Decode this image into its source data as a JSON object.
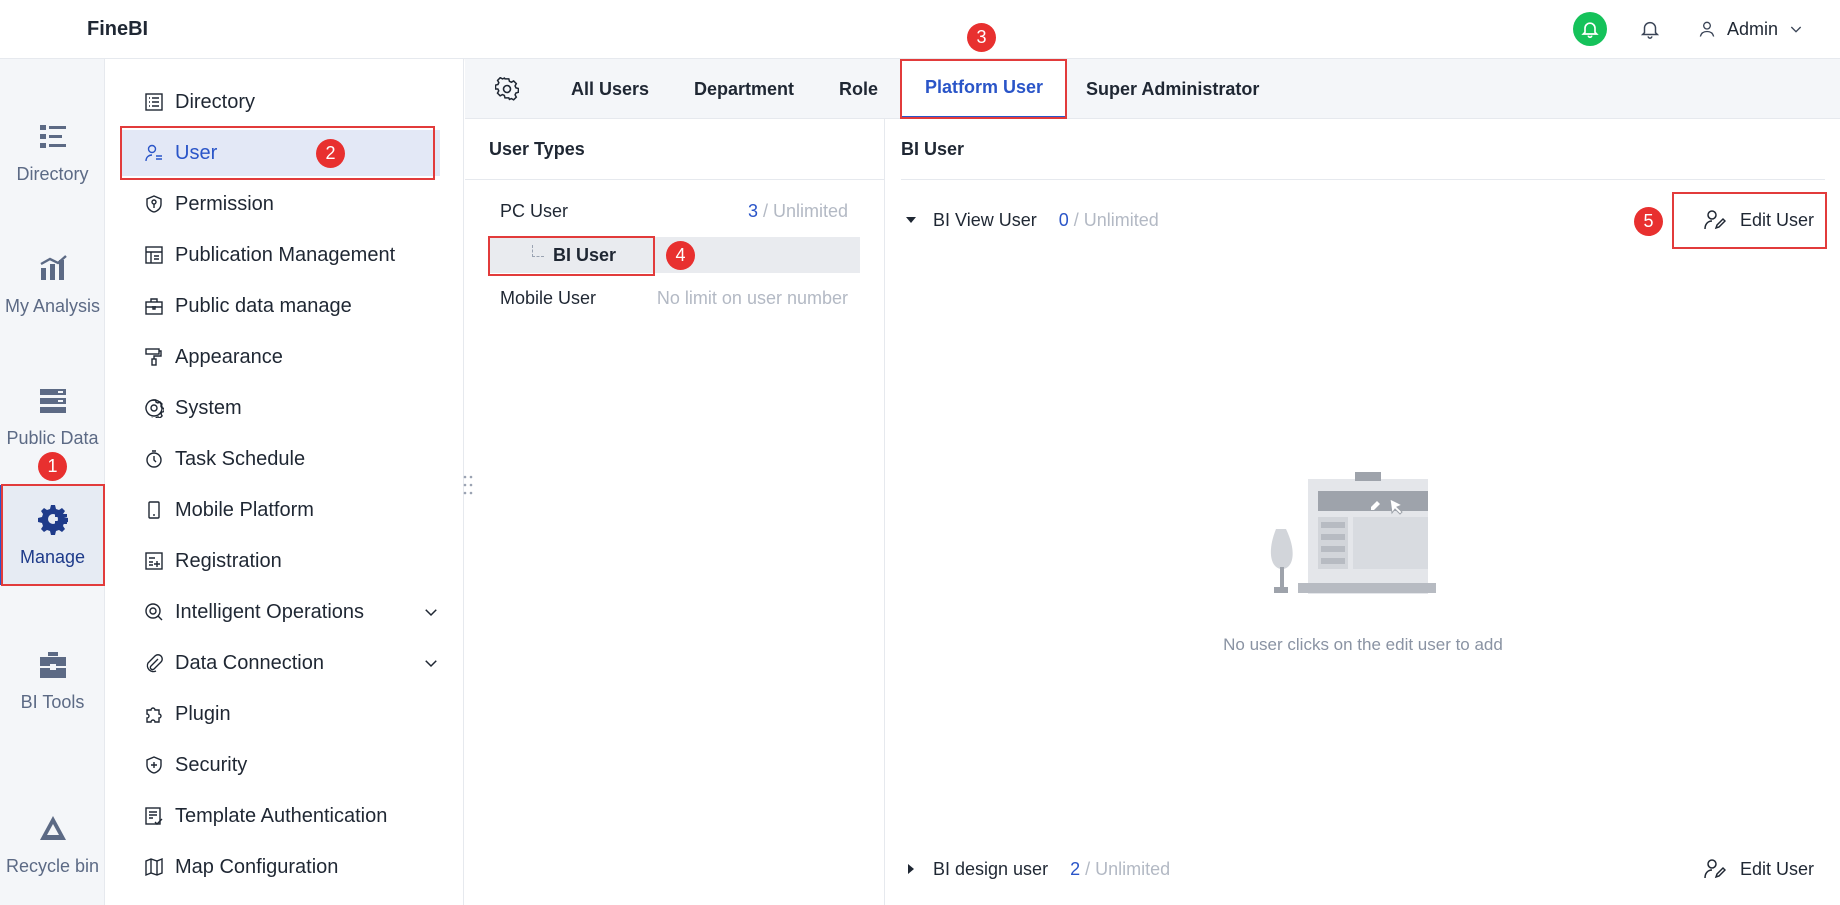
{
  "app": {
    "title": "FineBI"
  },
  "header": {
    "admin_label": "Admin"
  },
  "rail": {
    "items": [
      {
        "label": "Directory",
        "icon": "directory-icon"
      },
      {
        "label": "My Analysis",
        "icon": "analysis-icon"
      },
      {
        "label": "Public Data",
        "icon": "public-data-icon"
      },
      {
        "label": "Manage",
        "icon": "manage-icon",
        "active": true
      },
      {
        "label": "BI Tools",
        "icon": "toolbox-icon"
      },
      {
        "label": "Recycle bin",
        "icon": "recycle-icon"
      }
    ]
  },
  "nav": {
    "items": [
      {
        "label": "Directory"
      },
      {
        "label": "User",
        "active": true
      },
      {
        "label": "Permission"
      },
      {
        "label": "Publication Management"
      },
      {
        "label": "Public data manage"
      },
      {
        "label": "Appearance"
      },
      {
        "label": "System"
      },
      {
        "label": "Task Schedule"
      },
      {
        "label": "Mobile Platform"
      },
      {
        "label": "Registration"
      },
      {
        "label": "Intelligent Operations",
        "expandable": true
      },
      {
        "label": "Data Connection",
        "expandable": true
      },
      {
        "label": "Plugin"
      },
      {
        "label": "Security"
      },
      {
        "label": "Template Authentication"
      },
      {
        "label": "Map Configuration"
      }
    ]
  },
  "tabs": {
    "items": [
      {
        "label": "All Users"
      },
      {
        "label": "Department"
      },
      {
        "label": "Role"
      },
      {
        "label": "Platform User",
        "active": true
      },
      {
        "label": "Super Administrator"
      }
    ]
  },
  "user_types": {
    "title": "User Types",
    "pc_user": {
      "label": "PC User",
      "count": "3",
      "limit": "/ Unlimited"
    },
    "bi_user": {
      "label": "BI User"
    },
    "mobile_user": {
      "label": "Mobile User",
      "limit_text": "No limit on user number"
    }
  },
  "bi_user_panel": {
    "title": "BI User",
    "view_group": {
      "label": "BI View User",
      "count": "0",
      "limit": "/ Unlimited",
      "edit_label": "Edit User"
    },
    "design_group": {
      "label": "BI design user",
      "count": "2",
      "limit": "/ Unlimited",
      "edit_label": "Edit User"
    },
    "empty_text": "No user clicks on the edit user to add"
  },
  "annotations": [
    "1",
    "2",
    "3",
    "4",
    "5"
  ],
  "colors": {
    "accent": "#2a55c8",
    "highlight": "#e23b3b",
    "badge": "#e8302f",
    "notify": "#15c25a"
  }
}
